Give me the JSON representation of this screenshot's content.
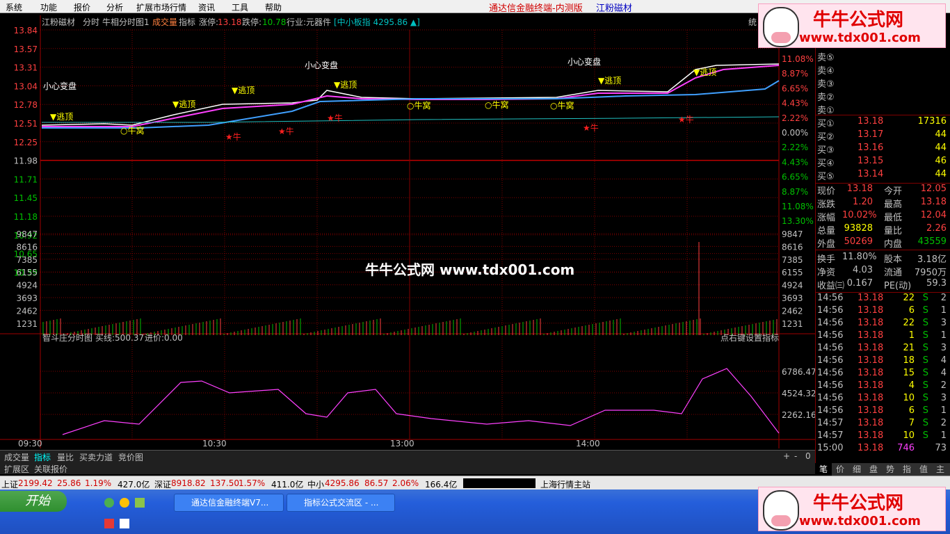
{
  "menu": {
    "items": [
      "系统",
      "功能",
      "报价",
      "分析",
      "扩展市场行情",
      "资讯",
      "工具",
      "帮助"
    ],
    "title": "通达信金融终端-内测版",
    "stock_title": "江粉磁材"
  },
  "header": {
    "stock": "江粉磁材",
    "mode": "分时",
    "indicator1": "牛相分时图1",
    "vol_label": "成交量",
    "ind_label": "指标",
    "up_limit_label": "涨停:",
    "up_limit": "13.18",
    "down_limit_label": "跌停:",
    "down_limit": "10.78",
    "industry": "行业:元器件",
    "index_info": "[中小板指 4295.86 ▲]",
    "right_char": "统"
  },
  "price_axis": {
    "left": [
      "13.84",
      "13.57",
      "13.31",
      "13.04",
      "12.78",
      "12.51",
      "12.25",
      "11.98",
      "11.71",
      "11.45",
      "11.18",
      "10.92",
      "10.65",
      "10.39"
    ],
    "right": [
      "11.08%",
      "8.87%",
      "6.65%",
      "4.43%",
      "2.22%",
      "0.00%",
      "2.22%",
      "4.43%",
      "6.65%",
      "8.87%",
      "11.08%",
      "13.30%"
    ],
    "up_color": "#ff4040",
    "down_color": "#00c000"
  },
  "volume_axis": [
    "9847",
    "8616",
    "7385",
    "6155",
    "4924",
    "3693",
    "2462",
    "1231"
  ],
  "signals": {
    "warn": "小心变盘",
    "escape": "▼逃顶",
    "nest": "○牛窝",
    "bull": "★牛"
  },
  "lower": {
    "title": "智斗庄分时图",
    "buy_line": "买线:500.37",
    "entry": "进价:0.00",
    "right_label": "点右键设置指标",
    "axis": [
      "6786.47",
      "4524.32",
      "2262.16"
    ]
  },
  "time_axis": [
    "09:30",
    "10:30",
    "13:00",
    "14:00"
  ],
  "watermark": "牛牛公式网  www.tdx001.com",
  "orders": {
    "sells": [
      "卖⑤",
      "卖④",
      "卖③",
      "卖②",
      "卖①"
    ],
    "buys": [
      {
        "l": "买①",
        "p": "13.18",
        "v": "17316"
      },
      {
        "l": "买②",
        "p": "13.17",
        "v": "44"
      },
      {
        "l": "买③",
        "p": "13.16",
        "v": "44"
      },
      {
        "l": "买④",
        "p": "13.15",
        "v": "46"
      },
      {
        "l": "买⑤",
        "p": "13.14",
        "v": "44"
      }
    ]
  },
  "quote": [
    {
      "k1": "现价",
      "v1": "13.18",
      "c1": "#ff4040",
      "k2": "今开",
      "v2": "12.05",
      "c2": "#ff4040"
    },
    {
      "k1": "涨跌",
      "v1": "1.20",
      "c1": "#ff4040",
      "k2": "最高",
      "v2": "13.18",
      "c2": "#ff4040"
    },
    {
      "k1": "涨幅",
      "v1": "10.02%",
      "c1": "#ff4040",
      "k2": "最低",
      "v2": "12.04",
      "c2": "#ff4040"
    },
    {
      "k1": "总量",
      "v1": "93828",
      "c1": "#ffff00",
      "k2": "量比",
      "v2": "2.26",
      "c2": "#ff4040"
    },
    {
      "k1": "外盘",
      "v1": "50269",
      "c1": "#ff4040",
      "k2": "内盘",
      "v2": "43559",
      "c2": "#00c000"
    },
    {
      "k1": "换手",
      "v1": "11.80%",
      "c1": "#c0c0c0",
      "k2": "股本",
      "v2": "3.18亿",
      "c2": "#c0c0c0"
    },
    {
      "k1": "净资",
      "v1": "4.03",
      "c1": "#c0c0c0",
      "k2": "流通",
      "v2": "7950万",
      "c2": "#c0c0c0"
    },
    {
      "k1": "收益㈢",
      "v1": "0.167",
      "c1": "#c0c0c0",
      "k2": "PE(动)",
      "v2": "59.3",
      "c2": "#c0c0c0"
    }
  ],
  "ticks": [
    {
      "t": "14:56",
      "p": "13.18",
      "v": "22",
      "f": "S",
      "n": "2"
    },
    {
      "t": "14:56",
      "p": "13.18",
      "v": "6",
      "f": "S",
      "n": "1"
    },
    {
      "t": "14:56",
      "p": "13.18",
      "v": "22",
      "f": "S",
      "n": "3"
    },
    {
      "t": "14:56",
      "p": "13.18",
      "v": "1",
      "f": "S",
      "n": "1"
    },
    {
      "t": "14:56",
      "p": "13.18",
      "v": "21",
      "f": "S",
      "n": "3"
    },
    {
      "t": "14:56",
      "p": "13.18",
      "v": "18",
      "f": "S",
      "n": "4"
    },
    {
      "t": "14:56",
      "p": "13.18",
      "v": "15",
      "f": "S",
      "n": "4"
    },
    {
      "t": "14:56",
      "p": "13.18",
      "v": "4",
      "f": "S",
      "n": "2"
    },
    {
      "t": "14:56",
      "p": "13.18",
      "v": "10",
      "f": "S",
      "n": "3"
    },
    {
      "t": "14:56",
      "p": "13.18",
      "v": "6",
      "f": "S",
      "n": "1"
    },
    {
      "t": "14:57",
      "p": "13.18",
      "v": "7",
      "f": "S",
      "n": "2"
    },
    {
      "t": "14:57",
      "p": "13.18",
      "v": "10",
      "f": "S",
      "n": "1"
    },
    {
      "t": "15:00",
      "p": "13.18",
      "v": "746",
      "f": "",
      "n": "73"
    }
  ],
  "rp_tabs": [
    "笔",
    "价",
    "细",
    "盘",
    "势",
    "指",
    "值",
    "主"
  ],
  "bottom_tabs": [
    "成交量",
    "指标",
    "量比",
    "买卖力道",
    "竞价图"
  ],
  "bottom_tabs2": [
    "扩展区",
    "关联报价"
  ],
  "status": {
    "sh_label": "上证",
    "sh": "2199.42",
    "sh_chg": "25.86",
    "sh_pct": "1.19%",
    "sh_amt": "427.0亿",
    "sz_label": "深证",
    "sz": "8918.82",
    "sz_chg": "137.50",
    "sz_pct": "1.57%",
    "sz_amt": "411.0亿",
    "zx_label": "中小",
    "zx": "4295.86",
    "zx_chg": "86.57",
    "zx_pct": "2.06%",
    "zx_amt": "166.4亿",
    "server": "上海行情主站"
  },
  "taskbar": {
    "start": "开始",
    "tasks": [
      "通达信金融终端V7...",
      "指标公式交流区 - ..."
    ]
  },
  "logo": {
    "name": "牛牛公式网",
    "url": "www.tdx001.com"
  }
}
